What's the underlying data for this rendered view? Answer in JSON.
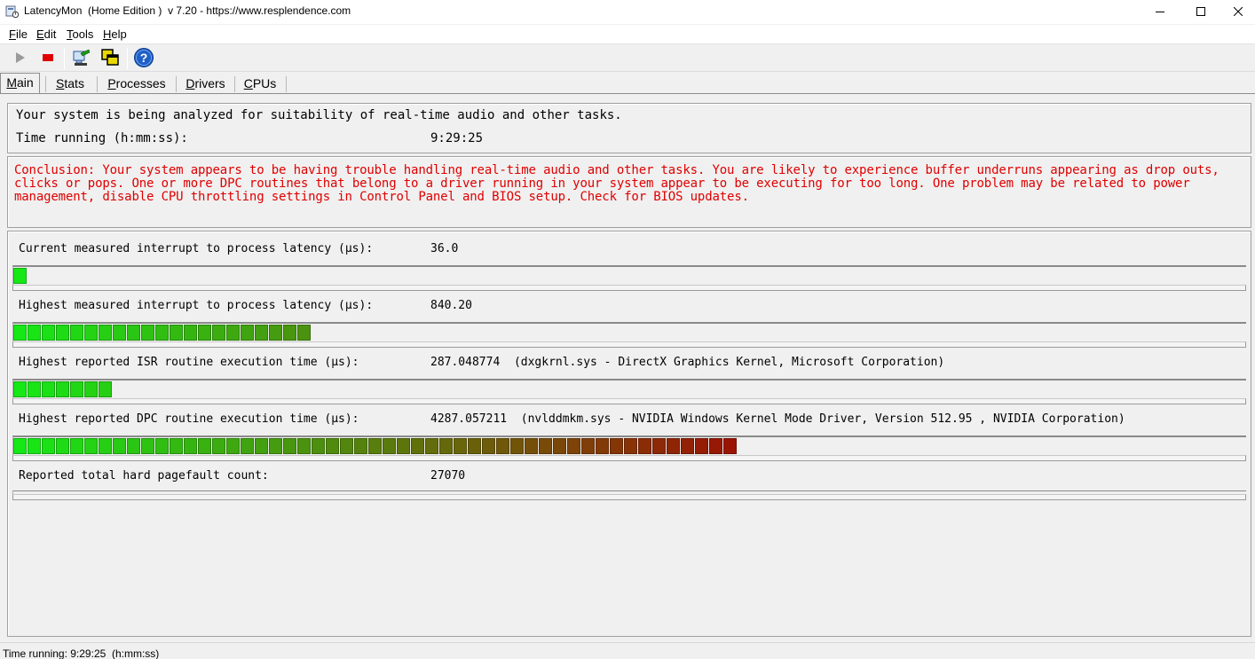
{
  "window": {
    "title": "LatencyMon  (Home Edition )  v 7.20 - https://www.resplendence.com",
    "minimize_icon": "minimize-icon",
    "maximize_icon": "maximize-icon",
    "close_icon": "close-icon"
  },
  "menu": {
    "items": [
      {
        "label": "File",
        "hotkey": "F",
        "rest": "ile"
      },
      {
        "label": "Edit",
        "hotkey": "E",
        "rest": "dit"
      },
      {
        "label": "Tools",
        "hotkey": "T",
        "rest": "ools"
      },
      {
        "label": "Help",
        "hotkey": "H",
        "rest": "elp"
      }
    ]
  },
  "toolbar": {
    "buttons": [
      {
        "icon": "play-icon",
        "color": "#9a9a9a"
      },
      {
        "icon": "stop-icon",
        "color": "#e00000"
      },
      {
        "icon": "properties-icon",
        "color": "#2a7fd4"
      },
      {
        "icon": "windows-icon",
        "color": "#e8d800"
      },
      {
        "icon": "help-icon",
        "color": "#1f5fc8"
      }
    ]
  },
  "tabs": [
    {
      "label": "Main",
      "hotkey": "M",
      "rest": "ain",
      "active": true
    },
    {
      "label": "Stats",
      "hotkey": "S",
      "rest": "tats",
      "active": false
    },
    {
      "label": "Processes",
      "hotkey": "P",
      "rest": "rocesses",
      "active": false
    },
    {
      "label": "Drivers",
      "hotkey": "D",
      "rest": "rivers",
      "active": false
    },
    {
      "label": "CPUs",
      "hotkey": "C",
      "rest": "PUs",
      "active": false
    }
  ],
  "status": {
    "message": "Your system is being analyzed for suitability of real-time audio and other tasks.",
    "time_label": "Time running (h:mm:ss):",
    "time_value": "9:29:25"
  },
  "conclusion": {
    "text": "Conclusion: Your system appears to be having trouble handling real-time audio and other tasks. You are likely to experience buffer underruns appearing as drop outs, clicks or pops. One or more DPC routines that belong to a driver running in your system appear to be executing for too long. One problem may be related to power management, disable CPU throttling settings in Control Panel and BIOS setup. Check for BIOS updates.",
    "color": "#e00000"
  },
  "metrics": [
    {
      "label": "Current measured interrupt to process latency (µs):",
      "value": "36.0",
      "detail": "",
      "bar_segments": 1
    },
    {
      "label": "Highest measured interrupt to process latency (µs):",
      "value": "840.20",
      "detail": "",
      "bar_segments": 21
    },
    {
      "label": "Highest reported ISR routine execution time (µs):",
      "value": "287.048774",
      "detail": "(dxgkrnl.sys - DirectX Graphics Kernel, Microsoft Corporation)",
      "bar_segments": 7
    },
    {
      "label": "Highest reported DPC routine execution time (µs):",
      "value": "4287.057211",
      "detail": "(nvlddmkm.sys - NVIDIA Windows Kernel Mode Driver, Version 512.95 , NVIDIA Corporation)",
      "bar_segments": 51
    },
    {
      "label": "Reported total hard pagefault count:",
      "value": "27070",
      "detail": "",
      "bar_segments": 0
    }
  ],
  "bar_colors": {
    "start": "#16e816",
    "end": "#9a1404"
  },
  "statusbar": {
    "text": "Time running: 9:29:25  (h:mm:ss)"
  }
}
